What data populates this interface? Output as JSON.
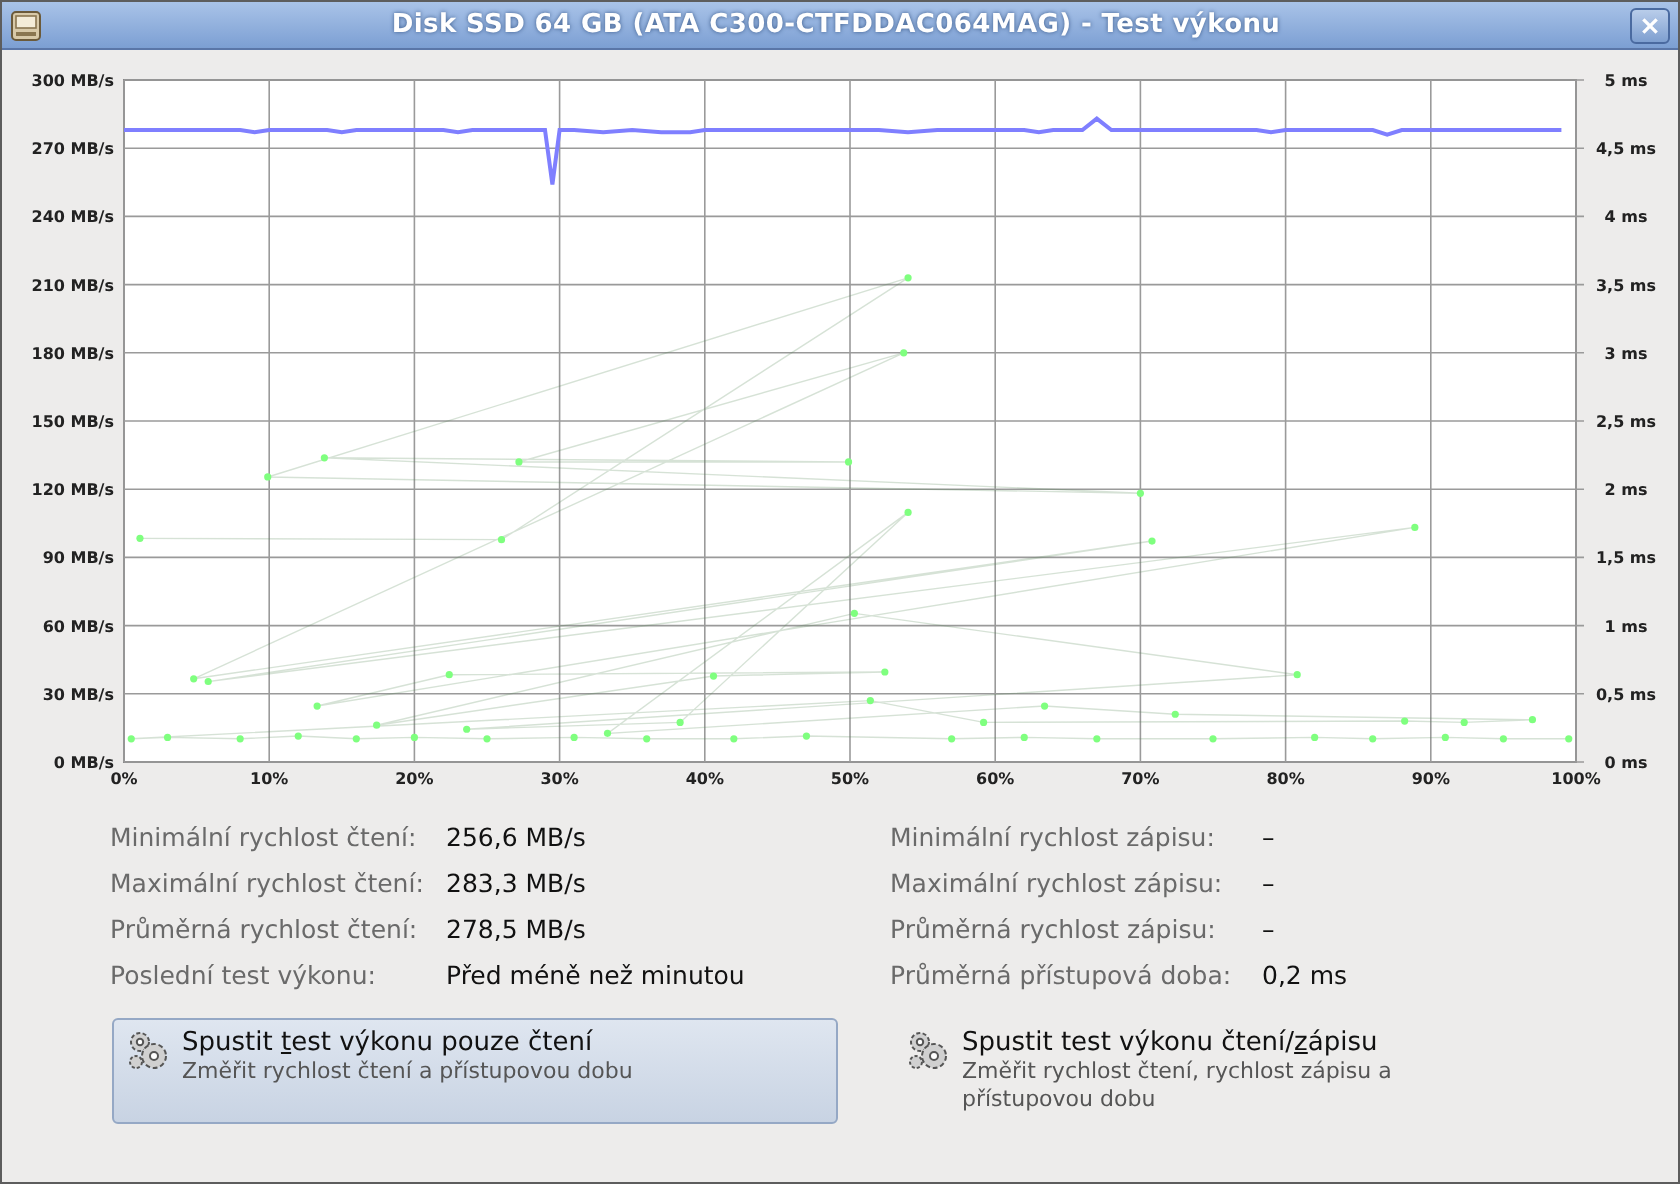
{
  "window": {
    "title": "Disk SSD 64 GB (ATA C300-CTFDDAC064MAG) - Test výkonu"
  },
  "chart": {
    "chart_data": {
      "type": "line",
      "grid": true,
      "xlim": [
        0,
        100
      ],
      "ylim": [
        0,
        300
      ],
      "y2lim": [
        0,
        5
      ],
      "xticks": [
        {
          "value": 0,
          "label": "0%"
        },
        {
          "value": 10,
          "label": "10%"
        },
        {
          "value": 20,
          "label": "20%"
        },
        {
          "value": 30,
          "label": "30%"
        },
        {
          "value": 40,
          "label": "40%"
        },
        {
          "value": 50,
          "label": "50%"
        },
        {
          "value": 60,
          "label": "60%"
        },
        {
          "value": 70,
          "label": "70%"
        },
        {
          "value": 80,
          "label": "80%"
        },
        {
          "value": 90,
          "label": "90%"
        },
        {
          "value": 100,
          "label": "100%"
        }
      ],
      "yticks": [
        {
          "value": 0,
          "label": "0 MB/s"
        },
        {
          "value": 30,
          "label": "30 MB/s"
        },
        {
          "value": 60,
          "label": "60 MB/s"
        },
        {
          "value": 90,
          "label": "90 MB/s"
        },
        {
          "value": 120,
          "label": "120 MB/s"
        },
        {
          "value": 150,
          "label": "150 MB/s"
        },
        {
          "value": 180,
          "label": "180 MB/s"
        },
        {
          "value": 210,
          "label": "210 MB/s"
        },
        {
          "value": 240,
          "label": "240 MB/s"
        },
        {
          "value": 270,
          "label": "270 MB/s"
        },
        {
          "value": 300,
          "label": "300 MB/s"
        }
      ],
      "y2ticks": [
        {
          "value": 0,
          "label": "0 ms"
        },
        {
          "value": 0.5,
          "label": "0,5 ms"
        },
        {
          "value": 1,
          "label": "1 ms"
        },
        {
          "value": 1.5,
          "label": "1,5 ms"
        },
        {
          "value": 2,
          "label": "2 ms"
        },
        {
          "value": 2.5,
          "label": "2,5 ms"
        },
        {
          "value": 3,
          "label": "3 ms"
        },
        {
          "value": 3.5,
          "label": "3,5 ms"
        },
        {
          "value": 4,
          "label": "4 ms"
        },
        {
          "value": 4.5,
          "label": "4,5 ms"
        },
        {
          "value": 5,
          "label": "5 ms"
        }
      ],
      "series": [
        {
          "color": "#7f7fff",
          "x": [
            0,
            2,
            4,
            6,
            8,
            9,
            10,
            12,
            14,
            15,
            16,
            18,
            20,
            22,
            23,
            24,
            26,
            28,
            29,
            29.5,
            30,
            31,
            33,
            35,
            37,
            39,
            40,
            42,
            44,
            46,
            48,
            50,
            52,
            54,
            56,
            58,
            60,
            62,
            63,
            64,
            65,
            66,
            67,
            68,
            70,
            72,
            74,
            76,
            78,
            79,
            80,
            82,
            84,
            86,
            87,
            88,
            90,
            92,
            94,
            96,
            98,
            99
          ],
          "values": [
            278,
            278,
            278,
            278,
            278,
            277,
            278,
            278,
            278,
            277,
            278,
            278,
            278,
            278,
            277,
            278,
            278,
            278,
            278,
            254,
            278,
            278,
            277,
            278,
            277,
            277,
            278,
            278,
            278,
            278,
            278,
            278,
            278,
            277,
            278,
            278,
            278,
            278,
            277,
            278,
            278,
            278,
            283,
            278,
            278,
            278,
            278,
            278,
            278,
            277,
            278,
            278,
            278,
            278,
            276,
            278,
            278,
            278,
            278,
            278,
            278,
            278
          ]
        },
        {
          "axis": "y2",
          "marker": true,
          "color": "#7fff7f",
          "x": [
            1.1,
            26,
            54,
            9.9,
            70,
            13.8,
            49.9,
            27.2,
            53.7,
            4.8,
            70.8,
            5.8,
            88.9,
            13.3,
            22.4,
            52.4,
            40.6,
            17.4,
            50.3,
            80.8,
            23.6,
            38.3,
            54,
            33.3,
            63.4,
            72.4,
            97,
            92.3,
            88.2,
            59.2,
            51.4,
            0.5,
            3,
            8,
            12,
            16,
            20,
            25,
            31,
            36,
            42,
            47,
            57,
            62,
            67,
            75,
            82,
            86,
            91,
            95,
            99.5
          ],
          "values": [
            1.64,
            1.63,
            3.55,
            2.09,
            1.97,
            2.23,
            2.2,
            2.2,
            3.0,
            0.61,
            1.62,
            0.59,
            1.72,
            0.41,
            0.64,
            0.66,
            0.63,
            0.27,
            1.09,
            0.64,
            0.24,
            0.29,
            1.83,
            0.21,
            0.41,
            0.35,
            0.31,
            0.29,
            0.3,
            0.29,
            0.45,
            0.17,
            0.18,
            0.17,
            0.19,
            0.17,
            0.18,
            0.17,
            0.18,
            0.17,
            0.17,
            0.19,
            0.17,
            0.18,
            0.17,
            0.17,
            0.18,
            0.17,
            0.18,
            0.17,
            0.17
          ]
        }
      ]
    }
  },
  "stats_left": [
    {
      "label": "Minimální rychlost čtení:",
      "value": "256,6 MB/s"
    },
    {
      "label": "Maximální rychlost čtení:",
      "value": "283,3 MB/s"
    },
    {
      "label": "Průměrná rychlost čtení:",
      "value": "278,5 MB/s"
    },
    {
      "label": "Poslední test výkonu:",
      "value": "Před méně než minutou"
    }
  ],
  "stats_right": [
    {
      "label": "Minimální rychlost zápisu:",
      "value": "–"
    },
    {
      "label": "Maximální rychlost zápisu:",
      "value": "–"
    },
    {
      "label": "Průměrná rychlost zápisu:",
      "value": "–"
    },
    {
      "label": "Průměrná přístupová doba:",
      "value": "0,2 ms"
    }
  ],
  "buttons": [
    {
      "label_pre": "Spustit ",
      "label_key": "t",
      "label_post": "est výkonu pouze čtení",
      "description": "Změřit rychlost čtení a přístupovou dobu",
      "highlighted": true
    },
    {
      "label_pre": "Spustit test výkonu čtení/",
      "label_key": "z",
      "label_post": "ápisu",
      "description": "Změřit rychlost čtení, rychlost zápisu a přístupovou dobu",
      "highlighted": false
    }
  ]
}
